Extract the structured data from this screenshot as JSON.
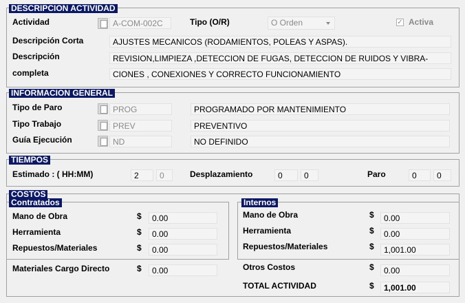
{
  "actividad": {
    "title": "DESCRIPCION ACTIVIDAD",
    "actividad_label": "Actividad",
    "actividad_value": "A-COM-002C",
    "tipo_label": "Tipo (O/R)",
    "tipo_value": "O Orden",
    "activa_label": "Activa",
    "activa_checked": true,
    "desc_corta_label": "Descripción Corta",
    "desc_corta_value": "AJUSTES MECANICOS (RODAMIENTOS, POLEAS Y ASPAS).",
    "desc_label_1": "Descripción",
    "desc_label_2": "completa",
    "desc_line_1": "REVISION,LIMPIEZA ,DETECCION DE FUGAS, DETECCION DE RUIDOS Y  VIBRA-",
    "desc_line_2": "CIONES , CONEXIONES Y CORRECTO FUNCIONAMIENTO"
  },
  "general": {
    "title": "INFORMACION GENERAL",
    "rows": [
      {
        "label": "Tipo de Paro",
        "code": "PROG",
        "desc": "PROGRAMADO POR MANTENIMIENTO"
      },
      {
        "label": "Tipo Trabajo",
        "code": "PREV",
        "desc": "PREVENTIVO"
      },
      {
        "label": "Guía Ejecución",
        "code": "ND",
        "desc": "NO DEFINIDO"
      }
    ]
  },
  "tiempos": {
    "title": "TIEMPOS",
    "estimado_label": "Estimado : ( HH:MM)",
    "estimado_h": "2",
    "estimado_m": "0",
    "desplazamiento_label": "Desplazamiento",
    "desplazamiento_h": "0",
    "desplazamiento_m": "0",
    "paro_label": "Paro",
    "paro_h": "0",
    "paro_m": "0"
  },
  "costos": {
    "title": "COSTOS",
    "currency": "$",
    "contratados": {
      "title": "Contratados",
      "rows": [
        {
          "label": "Mano de Obra",
          "value": "0.00"
        },
        {
          "label": "Herramienta",
          "value": "0.00"
        },
        {
          "label": "Repuestos/Materiales",
          "value": "0.00"
        }
      ]
    },
    "internos": {
      "title": "Internos",
      "rows": [
        {
          "label": "Mano de Obra",
          "value": "0.00"
        },
        {
          "label": "Herramienta",
          "value": "0.00"
        },
        {
          "label": "Repuestos/Materiales",
          "value": "1,001.00"
        }
      ]
    },
    "materiales_label": "Materiales Cargo Directo",
    "materiales_value": "0.00",
    "otros_label": "Otros Costos",
    "otros_value": "0.00",
    "total_label": "TOTAL ACTIVIDAD",
    "total_value": "1,001.00"
  }
}
